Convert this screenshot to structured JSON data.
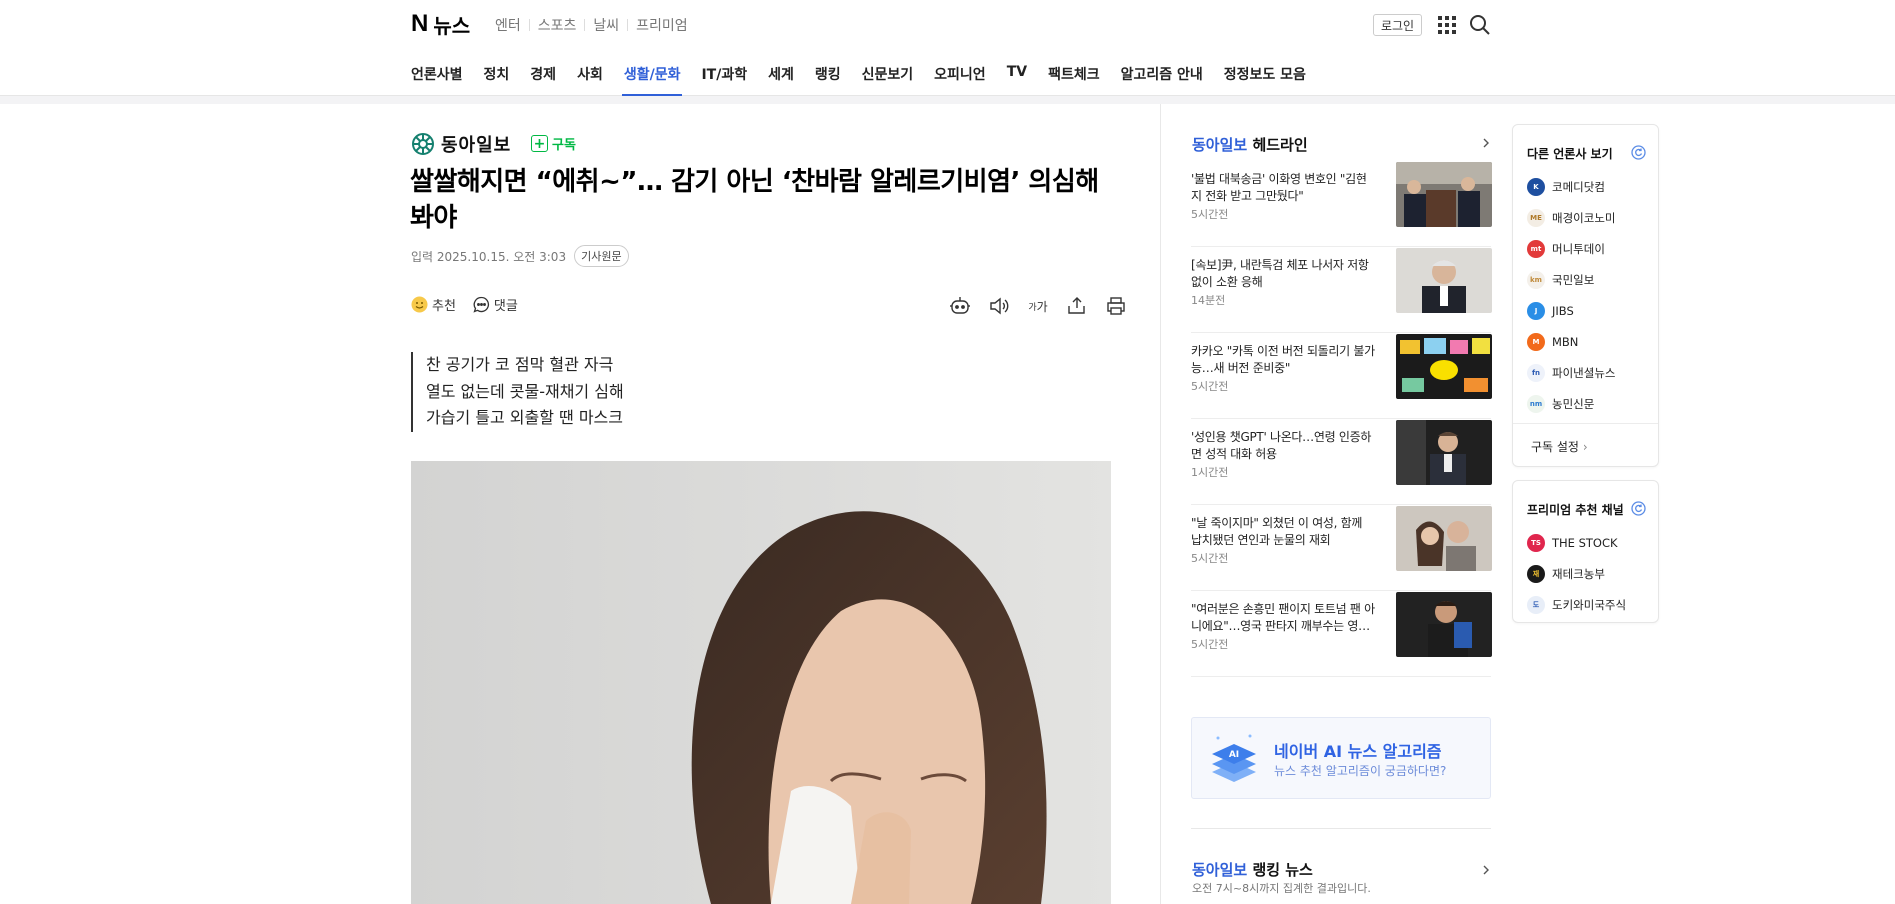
{
  "header": {
    "logo_n": "N",
    "logo_text": "뉴스",
    "services": [
      "엔터",
      "스포츠",
      "날씨",
      "프리미엄"
    ],
    "login_label": "로그인"
  },
  "nav": {
    "items": [
      "언론사별",
      "정치",
      "경제",
      "사회",
      "생활/문화",
      "IT/과학",
      "세계",
      "랭킹",
      "신문보기",
      "오피니언",
      "TV",
      "팩트체크",
      "알고리즘 안내",
      "정정보도 모음"
    ],
    "active": "생활/문화"
  },
  "article": {
    "press_name": "동아일보",
    "subscribe_label": "구독",
    "headline": "쌀쌀해지면 “에취~”… 감기 아닌 ‘찬바람 알레르기비염’ 의심해 봐야",
    "date_label": "입력 2025.10.15. 오전 3:03",
    "original_label": "기사원문",
    "recommend_label": "추천",
    "comment_label": "댓글",
    "font_size_label": "가",
    "summary": [
      "찬 공기가 코 점막 혈관 자극",
      "열도 없는데 콧물-재채기 심해",
      "가습기 틀고 외출할 땐 마스크"
    ]
  },
  "headline_section": {
    "press": "동아일보",
    "title": "헤드라인",
    "items": [
      {
        "text": "'불법 대북송금' 이화영 변호인 \"김현지 전화 받고 그만뒀다\"",
        "time": "5시간전"
      },
      {
        "text": "[속보]尹, 내란특검 체포 나서자 저항 없이 소환 응해",
        "time": "14분전"
      },
      {
        "text": "카카오 \"카톡 이전 버전 되돌리기 불가능…새 버전 준비중\"",
        "time": "5시간전"
      },
      {
        "text": "'성인용 챗GPT' 나온다…연령 인증하면 성적 대화 허용",
        "time": "1시간전"
      },
      {
        "text": "\"날 죽이지마\" 외쳤던 이 여성, 함께 납치됐던 연인과 눈물의 재회",
        "time": "5시간전"
      },
      {
        "text": "\"여러분은 손흥민 팬이지 토트넘 팬 아니에요\"…영국 판타지 깨부수는 영…",
        "time": "5시간전"
      }
    ]
  },
  "ai_banner": {
    "badge": "AI",
    "title": "네이버 AI 뉴스 알고리즘",
    "subtitle": "뉴스 추천 알고리즘이 궁금하다면?"
  },
  "ranking": {
    "press": "동아일보",
    "title": "랭킹 뉴스",
    "subtitle": "오전 7시~8시까지 집계한 결과입니다."
  },
  "other_press": {
    "title": "다른 언론사 보기",
    "items": [
      "코메디닷컴",
      "매경이코노미",
      "머니투데이",
      "국민일보",
      "JIBS",
      "MBN",
      "파이낸셜뉴스",
      "농민신문"
    ],
    "setting_label": "구독 설정"
  },
  "premium": {
    "title": "프리미엄 추천 채널",
    "items": [
      "THE STOCK",
      "재테크농부",
      "도키와미국주식"
    ]
  },
  "colors": {
    "accent": "#3060d8",
    "subscribe": "#00b843"
  }
}
